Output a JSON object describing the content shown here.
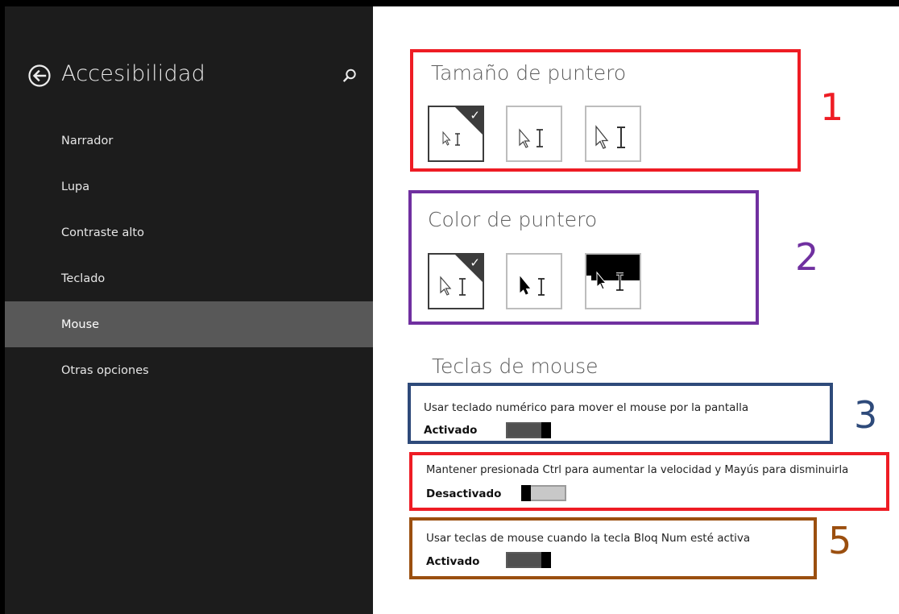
{
  "sidebar": {
    "title": "Accesibilidad",
    "back_icon": "back-arrow-icon",
    "search_icon": "search-icon",
    "items": [
      {
        "label": "Narrador",
        "selected": false
      },
      {
        "label": "Lupa",
        "selected": false
      },
      {
        "label": "Contraste alto",
        "selected": false
      },
      {
        "label": "Teclado",
        "selected": false
      },
      {
        "label": "Mouse",
        "selected": true
      },
      {
        "label": "Otras opciones",
        "selected": false
      }
    ]
  },
  "pointer_size": {
    "title": "Tamaño de puntero",
    "annotation": "1",
    "options": [
      {
        "size": "small",
        "selected": true
      },
      {
        "size": "medium",
        "selected": false
      },
      {
        "size": "large",
        "selected": false
      }
    ]
  },
  "pointer_color": {
    "title": "Color de puntero",
    "annotation": "2",
    "options": [
      {
        "color": "white",
        "selected": true
      },
      {
        "color": "black",
        "selected": false
      },
      {
        "color": "inverted",
        "selected": false
      }
    ]
  },
  "mouse_keys": {
    "title": "Teclas de mouse",
    "options": [
      {
        "label": "Usar teclado numérico para mover el mouse por la pantalla",
        "state": "Activado",
        "on": true,
        "annotation": "3"
      },
      {
        "label": "Mantener presionada Ctrl para aumentar la velocidad y Mayús para disminuirla",
        "state": "Desactivado",
        "on": false
      },
      {
        "label": "Usar teclas de mouse cuando la tecla Bloq Num esté activa",
        "state": "Activado",
        "on": true,
        "annotation": "5"
      }
    ]
  },
  "colors": {
    "sidebar_bg": "#1c1c1c",
    "selected_item": "#585858",
    "annotation_red": "#ee1c24",
    "annotation_purple": "#7030a0",
    "annotation_blue": "#2e4a7a",
    "annotation_brown": "#9b4f0f"
  }
}
